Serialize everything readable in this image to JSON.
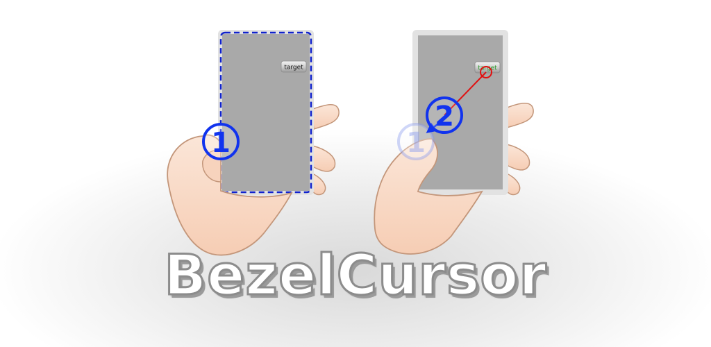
{
  "left_panel": {
    "target_label": "target",
    "step_label": "1"
  },
  "right_panel": {
    "target_label": "target",
    "previous_step_label": "1",
    "step_label": "2"
  },
  "wordmark": {
    "text": "BezelCursor"
  },
  "colors": {
    "step_marker_blue": "#1133ee",
    "dashed_edge_blue": "#1022cc",
    "cursor_line_red": "#e01010",
    "screen_gray": "#a9a9a9",
    "bezel_light_gray": "#e2e2e2",
    "skin": "#fbdcc6",
    "skin_outline": "#c3967a"
  }
}
